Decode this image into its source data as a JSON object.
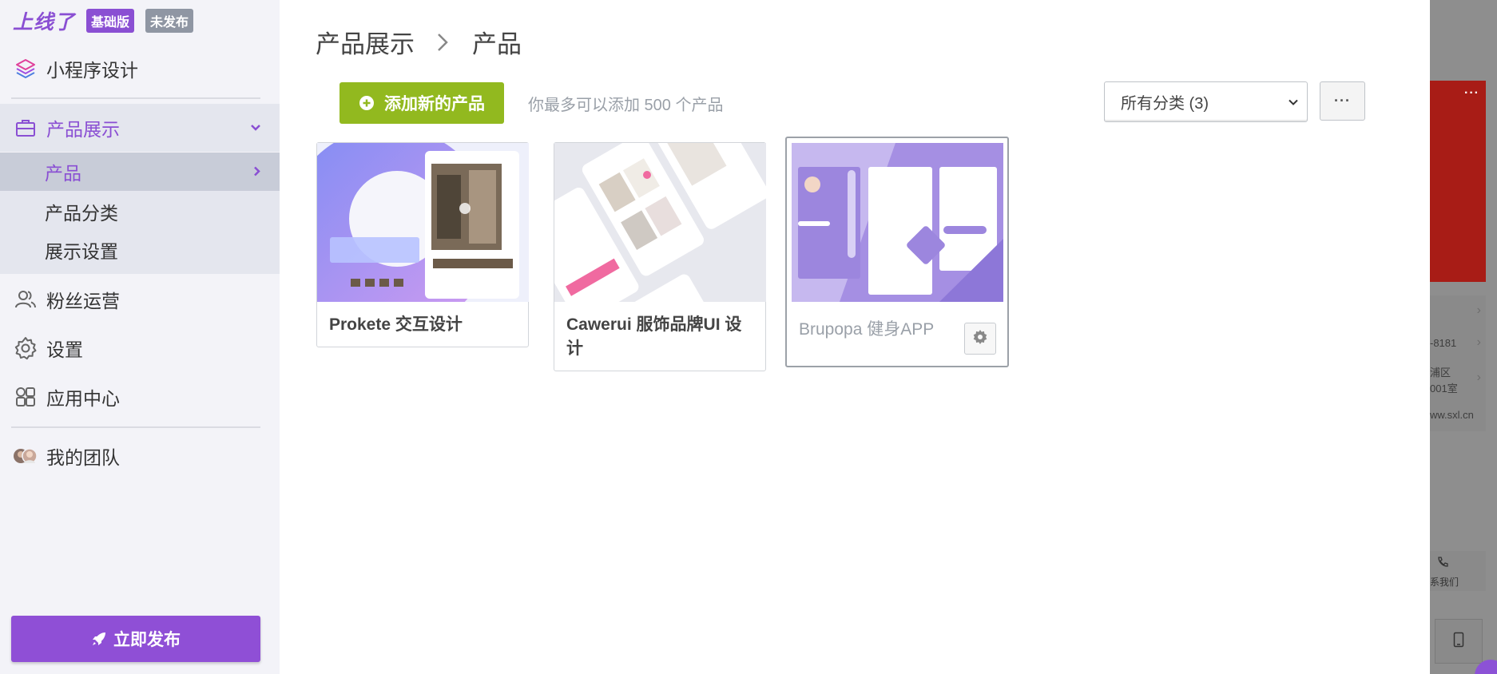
{
  "brand": {
    "logo": "上线了",
    "plan_badge": "基础版",
    "status_badge": "未发布"
  },
  "sidebar": {
    "items": [
      {
        "label": "小程序设计",
        "icon": "layers-icon"
      },
      {
        "label": "产品展示",
        "icon": "briefcase-icon",
        "expanded": true
      },
      {
        "label": "粉丝运营",
        "icon": "users-icon"
      },
      {
        "label": "设置",
        "icon": "gear-icon"
      },
      {
        "label": "应用中心",
        "icon": "apps-icon"
      },
      {
        "label": "我的团队",
        "icon": "team-avatars-icon"
      }
    ],
    "subitems": [
      {
        "label": "产品",
        "current": true
      },
      {
        "label": "产品分类"
      },
      {
        "label": "展示设置"
      }
    ],
    "publish_label": "立即发布"
  },
  "main": {
    "breadcrumb": [
      "产品展示",
      "产品"
    ],
    "add_button_label": "添加新的产品",
    "add_hint": "你最多可以添加 500 个产品",
    "category_select_value": "所有分类 (3)",
    "more_label": "···",
    "products": [
      {
        "title": "Prokete 交互设计"
      },
      {
        "title": "Cawerui 服饰品牌UI 设计"
      },
      {
        "title": "Brupopa 健身APP",
        "selected": true
      }
    ]
  },
  "preview": {
    "menu_dots": "···",
    "phone_text": "-8181",
    "address_line1": "浦区",
    "address_line2": "001室",
    "website": "ww.sxl.cn",
    "contact_label": "系我们"
  },
  "colors": {
    "accent": "#8a4fd3",
    "add_green": "#92b91f",
    "sidebar_bg": "#f3f3f8",
    "sub_bg": "#e4e6ee"
  }
}
